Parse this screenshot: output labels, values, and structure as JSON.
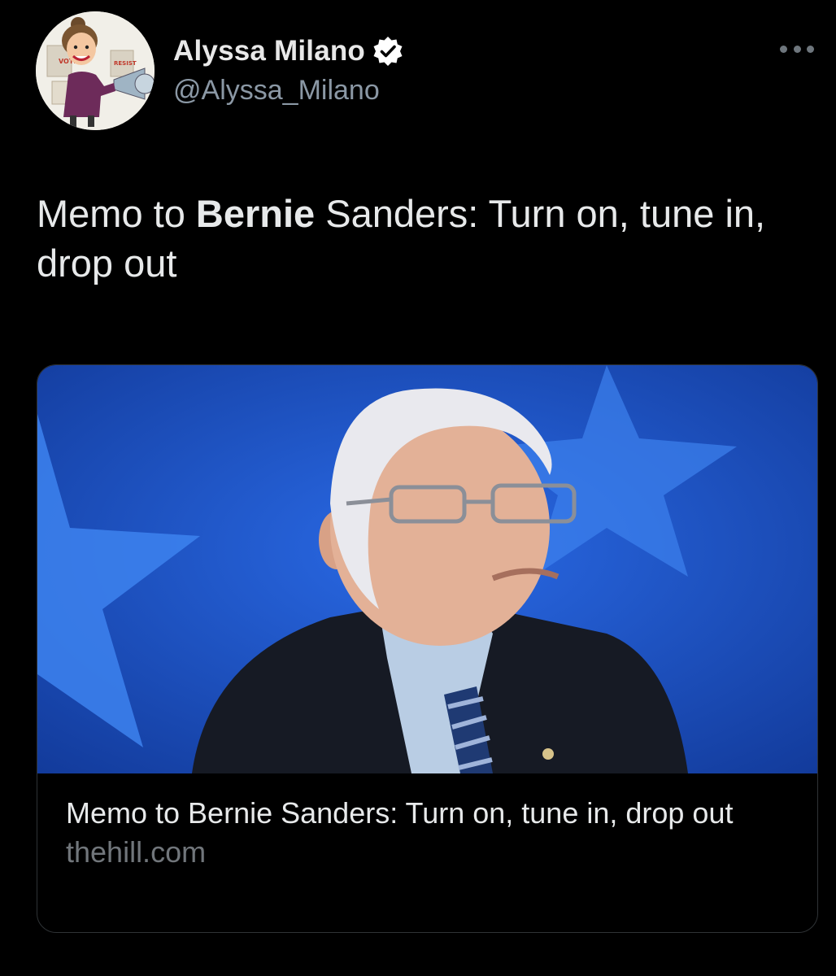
{
  "author": {
    "display_name": "Alyssa Milano",
    "handle": "@Alyssa_Milano",
    "verified": true,
    "avatar_icon": "avatar-caricature-icon"
  },
  "menu": {
    "icon": "more-options-icon"
  },
  "tweet": {
    "text_parts": [
      {
        "text": "Memo to ",
        "bold": false
      },
      {
        "text": "Bernie",
        "bold": true
      },
      {
        "text": " Sanders: Turn on, tune in, drop out",
        "bold": false
      }
    ]
  },
  "link_card": {
    "title": "Memo to Bernie Sanders: Turn on, tune in, drop out",
    "domain": "thehill.com"
  },
  "colors": {
    "background": "#000000",
    "primary_text": "#e7e9ea",
    "secondary_text": "#8b98a5",
    "verified_badge": "#ffffff",
    "card_border": "#2f3336",
    "image_background": "#1b4fc4"
  }
}
